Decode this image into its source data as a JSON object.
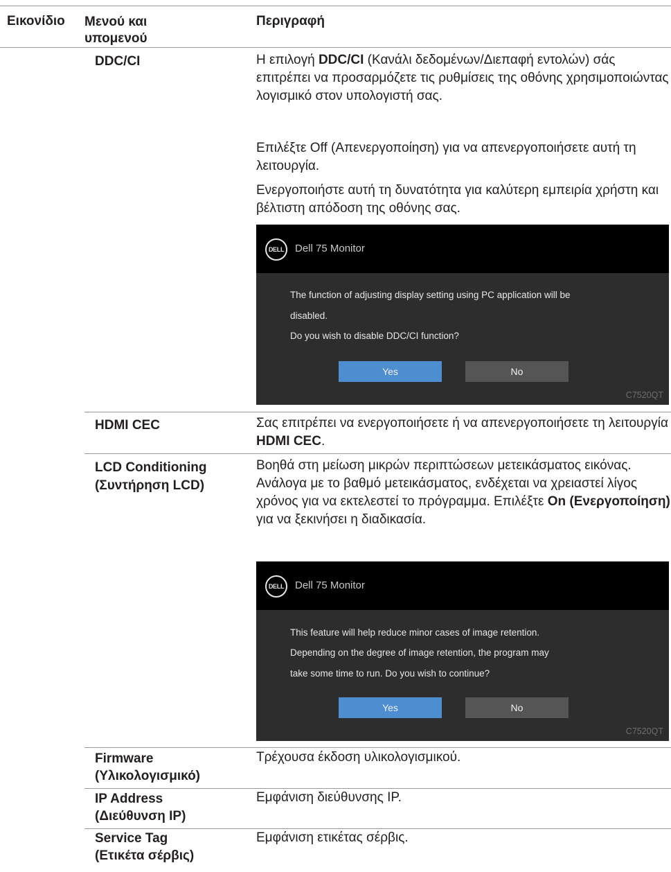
{
  "header": {
    "icon_col": "Εικονίδιο",
    "menu_col_line1": "Μενού και",
    "menu_col_line2": "υπομενού",
    "desc_col": "Περιγραφή"
  },
  "rows": {
    "ddcci": {
      "name": "DDC/CI",
      "p1_pre": "Η επιλογή ",
      "p1_bold": "DDC/CI",
      "p1_post": " (Κανάλι δεδομένων/Διεπαφή εντολών) σάς επιτρέπει να προσαρμόζετε τις ρυθμίσεις της οθόνης χρησιμοποιώντας λογισμικό στον υπολογιστή σας.",
      "p2": "Επιλέξτε Off (Απενεργοποίηση) για να απενεργοποιήσετε αυτή τη λειτουργία.",
      "p3": "Ενεργοποιήστε αυτή τη δυνατότητα για καλύτερη εμπειρία χρήστη και βέλτιστη απόδοση της οθόνης σας.",
      "osd": {
        "logo": "DELL",
        "title": "Dell 75 Monitor",
        "msg_line1": "The function of adjusting display setting using PC application will be",
        "msg_line2": "disabled.",
        "msg_line3": "Do you wish to disable DDC/CI function?",
        "yes": "Yes",
        "no": "No",
        "model": "C7520QT"
      }
    },
    "hdmi": {
      "name": "HDMI CEC",
      "desc_pre": "Σας επιτρέπει να ενεργοποιήσετε ή να απενεργοποιήσετε τη λειτουργία ",
      "desc_bold": "HDMI CEC",
      "desc_post": "."
    },
    "lcd": {
      "name_line1": "LCD Conditioning",
      "name_line2": "(Συντήρηση LCD)",
      "desc_pre": "Βοηθά στη μείωση μικρών περιπτώσεων μετεικάσματος εικόνας. Ανάλογα με το βαθμό μετεικάσματος, ενδέχεται να χρειαστεί λίγος χρόνος για να εκτελεστεί το πρόγραμμα. Επιλέξτε ",
      "desc_bold": "On (Ενεργοποίηση)",
      "desc_post": " για να ξεκινήσει η διαδικασία.",
      "osd": {
        "logo": "DELL",
        "title": "Dell 75 Monitor",
        "msg_line1": "This feature will help reduce minor cases of image retention.",
        "msg_line2": "Depending on the degree of image retention, the program may",
        "msg_line3": "take some time to run. Do you wish to continue?",
        "yes": "Yes",
        "no": "No",
        "model": "C7520QT"
      }
    },
    "firmware": {
      "name_line1": "Firmware",
      "name_line2": "(Υλικολογισμικό)",
      "desc": "Τρέχουσα έκδοση υλικολογισμικού."
    },
    "ip": {
      "name_line1": "IP Address",
      "name_line2": "(Διεύθυνση IP)",
      "desc": "Εμφάνιση διεύθυνσης IP."
    },
    "service": {
      "name_line1": "Service Tag",
      "name_line2": "(Ετικέτα σέρβις)",
      "desc": "Εμφάνιση ετικέτας σέρβις."
    }
  },
  "colors": {
    "yes_button": "#4e8ed0",
    "no_button": "#555555",
    "osd_body": "#2d2d2d",
    "osd_header": "#000000",
    "rule": "#9a9a9a"
  }
}
